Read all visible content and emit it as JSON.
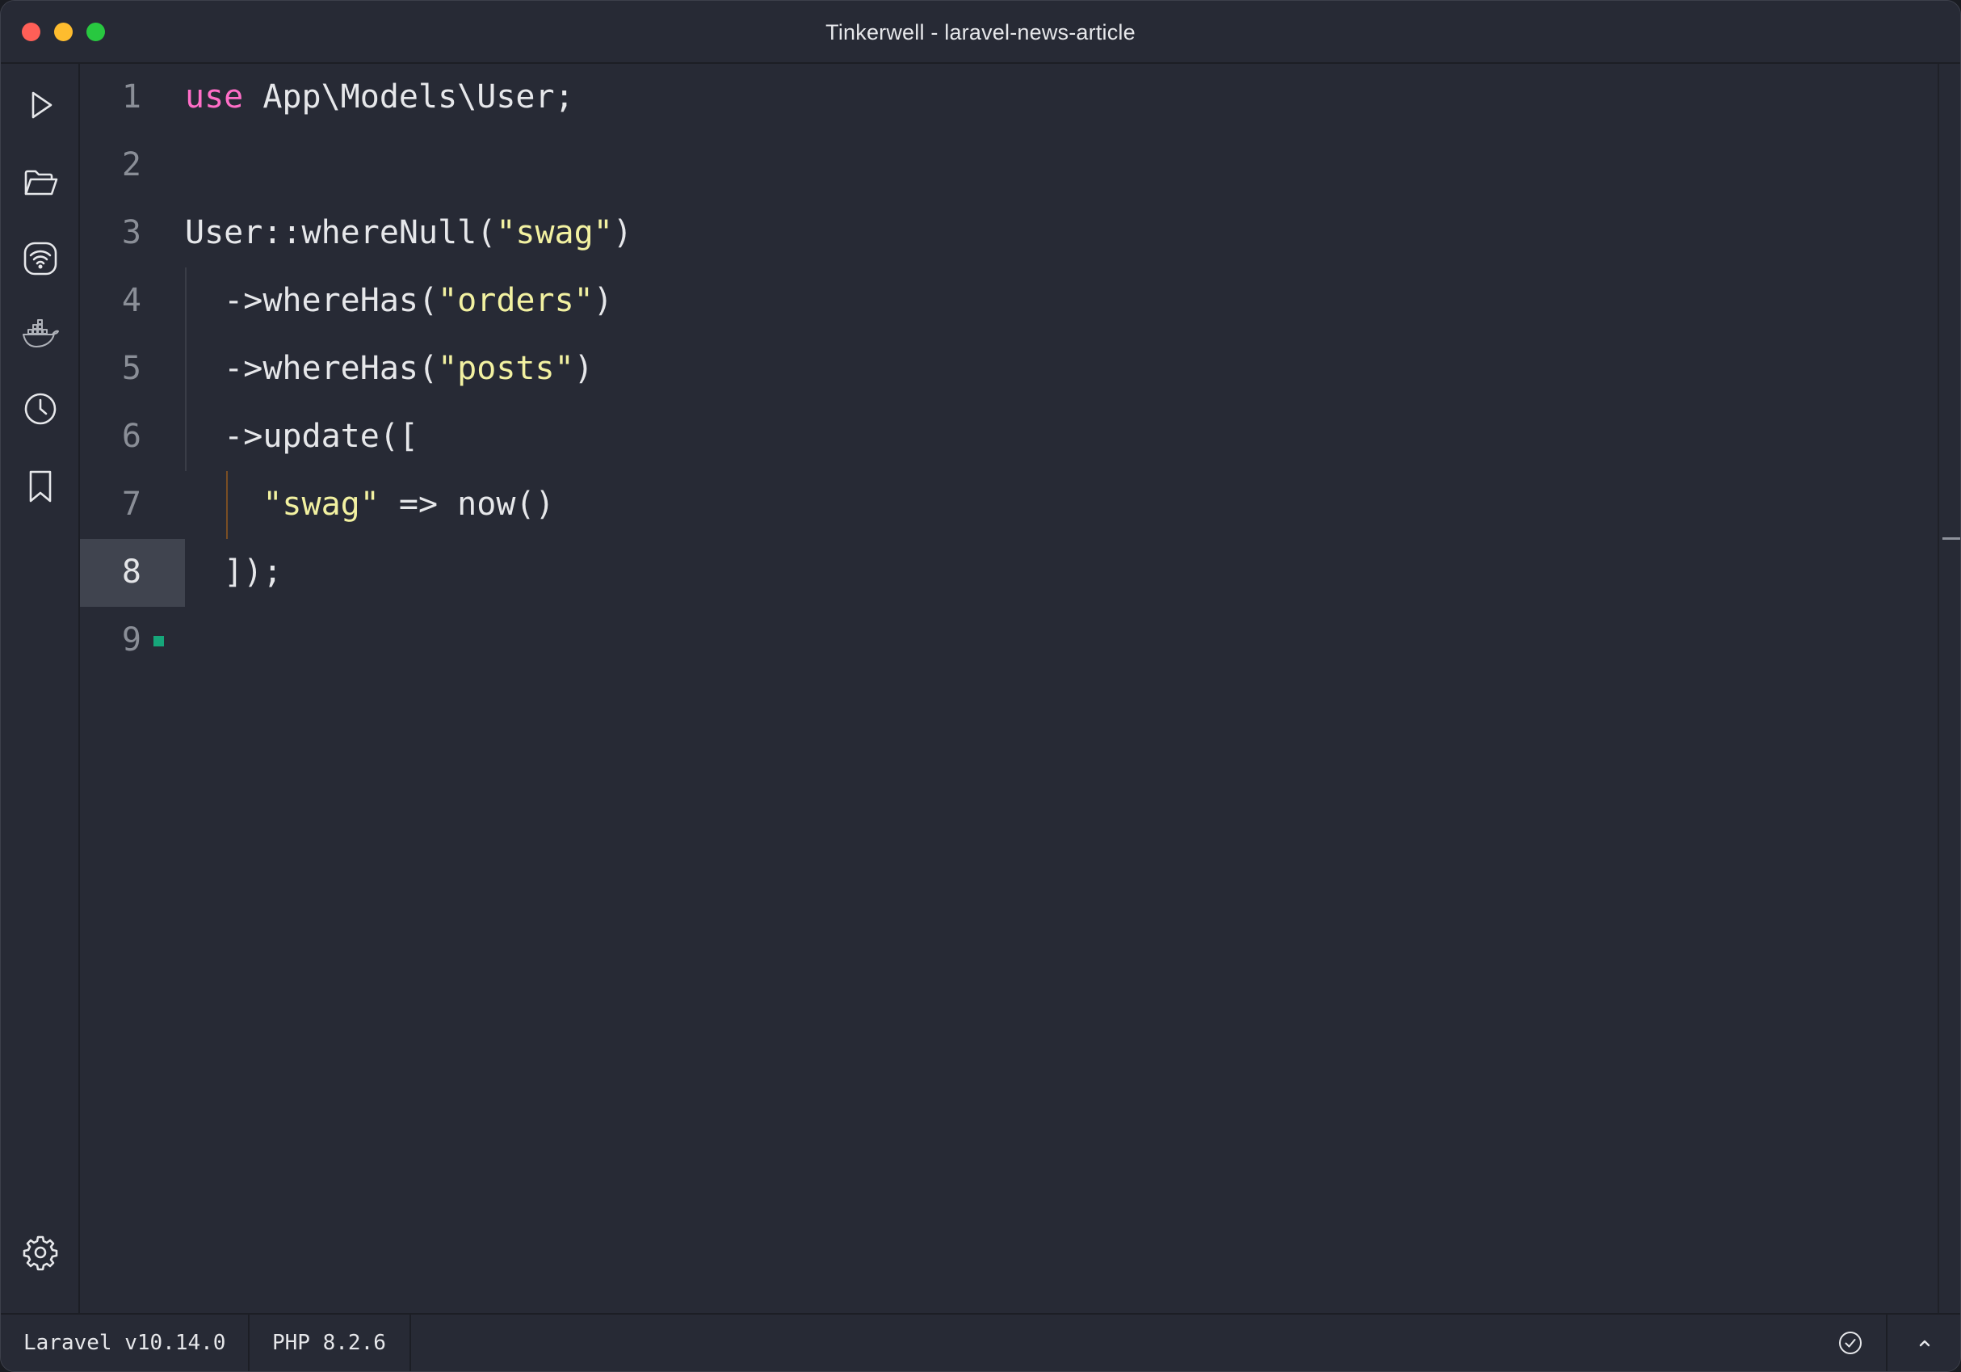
{
  "window": {
    "title": "Tinkerwell - laravel-news-article"
  },
  "sidebar": {
    "items": [
      {
        "name": "run-button",
        "icon": "play-icon"
      },
      {
        "name": "open-file-button",
        "icon": "folder-open-icon"
      },
      {
        "name": "remote-connection-button",
        "icon": "wifi-icon"
      },
      {
        "name": "docker-button",
        "icon": "docker-icon"
      },
      {
        "name": "history-button",
        "icon": "clock-icon"
      },
      {
        "name": "snippets-button",
        "icon": "bookmark-icon"
      },
      {
        "name": "settings-button",
        "icon": "gear-icon"
      }
    ]
  },
  "editor": {
    "active_line": "8",
    "lines": [
      {
        "number": "1",
        "tokens": [
          {
            "t": "kw",
            "v": "use"
          },
          {
            "t": "plain",
            "v": " App\\Models\\User;"
          }
        ]
      },
      {
        "number": "2",
        "tokens": []
      },
      {
        "number": "3",
        "tokens": [
          {
            "t": "plain",
            "v": "User::whereNull("
          },
          {
            "t": "str",
            "v": "\"swag\""
          },
          {
            "t": "plain",
            "v": ")"
          }
        ]
      },
      {
        "number": "4",
        "tokens": [
          {
            "t": "plain",
            "v": "  ->whereHas("
          },
          {
            "t": "str",
            "v": "\"orders\""
          },
          {
            "t": "plain",
            "v": ")"
          }
        ]
      },
      {
        "number": "5",
        "tokens": [
          {
            "t": "plain",
            "v": "  ->whereHas("
          },
          {
            "t": "str",
            "v": "\"posts\""
          },
          {
            "t": "plain",
            "v": ")"
          }
        ]
      },
      {
        "number": "6",
        "tokens": [
          {
            "t": "plain",
            "v": "  ->update(["
          }
        ]
      },
      {
        "number": "7",
        "tokens": [
          {
            "t": "plain",
            "v": "    "
          },
          {
            "t": "str",
            "v": "\"swag\""
          },
          {
            "t": "plain",
            "v": " => now()"
          }
        ]
      },
      {
        "number": "8",
        "tokens": [
          {
            "t": "plain",
            "v": "  ]);"
          }
        ]
      },
      {
        "number": "9",
        "tokens": []
      }
    ]
  },
  "statusbar": {
    "laravel_version": "Laravel v10.14.0",
    "php_version": "PHP 8.2.6",
    "status_icon": "check-circle-icon",
    "toggle_icon": "chevron-up-icon"
  },
  "colors": {
    "background": "#272a35",
    "keyword": "#ff6ec7",
    "string": "#f2f1a1",
    "text": "#e6e7ea",
    "line_number": "#8a8e97",
    "active_line_bg": "#40444f",
    "cursor_marker": "#16a67a"
  }
}
